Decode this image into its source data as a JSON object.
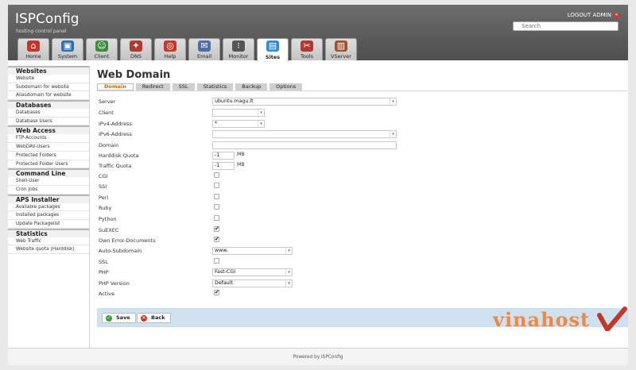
{
  "app": {
    "title": "ISPConfig",
    "tagline": "hosting control panel",
    "logout_label": "LOGOUT ADMIN"
  },
  "search": {
    "placeholder": "Search"
  },
  "nav_tabs": [
    {
      "label": "Home",
      "icon": "home-icon",
      "color": "#c0392b"
    },
    {
      "label": "System",
      "icon": "computer-icon",
      "color": "#2c6fb7"
    },
    {
      "label": "Client",
      "icon": "users-icon",
      "color": "#3a8a3a"
    },
    {
      "label": "DNS",
      "icon": "network-icon",
      "color": "#b03a2e"
    },
    {
      "label": "Help",
      "icon": "lifebuoy-icon",
      "color": "#c0392b"
    },
    {
      "label": "Email",
      "icon": "envelope-icon",
      "color": "#4d6fa8"
    },
    {
      "label": "Monitor",
      "icon": "traffic-light-icon",
      "color": "#555555"
    },
    {
      "label": "Sites",
      "icon": "sites-icon",
      "color": "#2e8bd0"
    },
    {
      "label": "Tools",
      "icon": "tools-icon",
      "color": "#b03a2e"
    },
    {
      "label": "VServer",
      "icon": "server-icon",
      "color": "#a0522d"
    }
  ],
  "active_tab": "Sites",
  "sidebar": [
    {
      "title": "Websites",
      "items": [
        "Website",
        "Subdomain for website",
        "Aliasdomain for website"
      ]
    },
    {
      "title": "Databases",
      "items": [
        "Databases",
        "Database Users"
      ]
    },
    {
      "title": "Web Access",
      "items": [
        "FTP-Accounts",
        "WebDAV-Users",
        "Protected Folders",
        "Protected Folder Users"
      ]
    },
    {
      "title": "Command Line",
      "items": [
        "Shell-User",
        "Cron Jobs"
      ]
    },
    {
      "title": "APS Installer",
      "items": [
        "Available packages",
        "Installed packages",
        "Update Packagelist"
      ]
    },
    {
      "title": "Statistics",
      "items": [
        "Web Traffic",
        "Website quota (Harddisk)"
      ]
    }
  ],
  "page": {
    "title": "Web Domain",
    "subtabs": [
      "Domain",
      "Redirect",
      "SSL",
      "Statistics",
      "Backup",
      "Options"
    ],
    "active_subtab": "Domain"
  },
  "form": {
    "server": {
      "label": "Server",
      "value": "ubuntu.magu.lt"
    },
    "client": {
      "label": "Client",
      "value": ""
    },
    "ipv4": {
      "label": "IPv4-Address",
      "value": "*"
    },
    "ipv6": {
      "label": "IPv6-Address",
      "value": ""
    },
    "domain": {
      "label": "Domain",
      "value": ""
    },
    "hd_quota": {
      "label": "Harddisk Quota",
      "value": "-1",
      "unit": "MB"
    },
    "traffic_quota": {
      "label": "Traffic Quota",
      "value": "-1",
      "unit": "MB"
    },
    "cgi": {
      "label": "CGI",
      "checked": false
    },
    "ssi": {
      "label": "SSI",
      "checked": false
    },
    "perl": {
      "label": "Perl",
      "checked": false
    },
    "ruby": {
      "label": "Ruby",
      "checked": false
    },
    "python": {
      "label": "Python",
      "checked": false
    },
    "suexec": {
      "label": "SuEXEC",
      "checked": true
    },
    "own_error": {
      "label": "Own Error-Documents",
      "checked": true
    },
    "auto_sub": {
      "label": "Auto-Subdomain",
      "value": "www."
    },
    "ssl": {
      "label": "SSL",
      "checked": false
    },
    "php": {
      "label": "PHP",
      "value": "Fast-CGI"
    },
    "php_version": {
      "label": "PHP Version",
      "value": "Default"
    },
    "active": {
      "label": "Active",
      "checked": true
    }
  },
  "buttons": {
    "save": "Save",
    "back": "Back"
  },
  "watermark": {
    "text": "vinahost"
  },
  "footer": {
    "text": "Powered by ISPConfig"
  }
}
